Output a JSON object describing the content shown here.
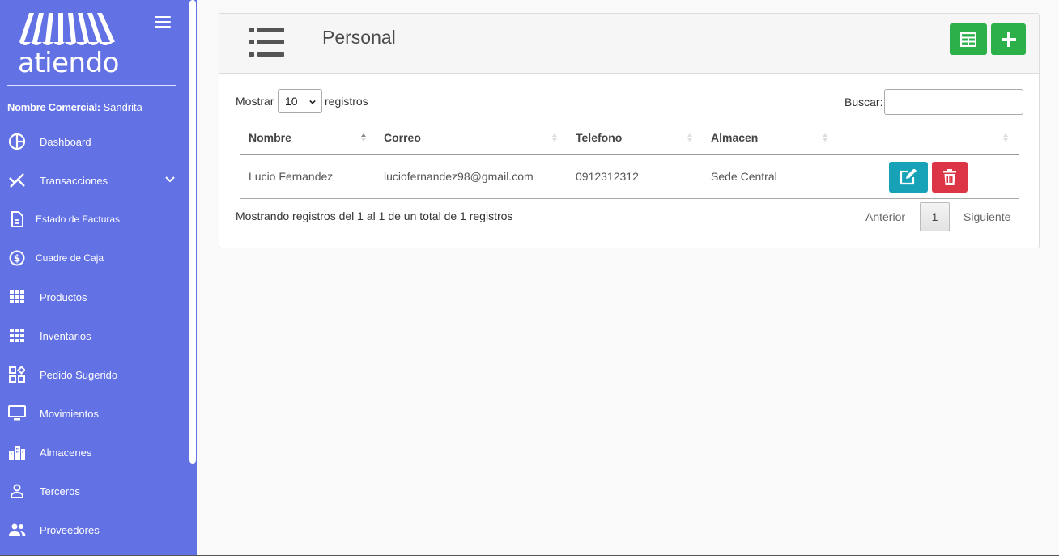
{
  "sidebar": {
    "logo_text": "atiendo",
    "merchant_label": "Nombre Comercial:",
    "merchant_value": " Sandrita",
    "items": [
      {
        "label": "Dashboard",
        "icon": "pie-chart-icon"
      },
      {
        "label": "Transacciones",
        "icon": "transactions-icon"
      },
      {
        "label": "Estado de Facturas",
        "icon": "document-icon"
      },
      {
        "label": "Cuadre de Caja",
        "icon": "dollar-circle-icon"
      },
      {
        "label": "Productos",
        "icon": "grid-icon"
      },
      {
        "label": "Inventarios",
        "icon": "grid-icon"
      },
      {
        "label": "Pedido Sugerido",
        "icon": "widgets-icon"
      },
      {
        "label": "Movimientos",
        "icon": "monitor-icon"
      },
      {
        "label": "Almacenes",
        "icon": "buildings-icon"
      },
      {
        "label": "Terceros",
        "icon": "person-icon"
      },
      {
        "label": "Proveedores",
        "icon": "people-icon"
      }
    ]
  },
  "header": {
    "title": "Personal"
  },
  "table_controls": {
    "show_label": "Mostrar",
    "length_value": "10",
    "records_label": "registros",
    "search_label": "Buscar:",
    "search_value": ""
  },
  "table": {
    "columns": [
      "Nombre",
      "Correo",
      "Telefono",
      "Almacen",
      ""
    ],
    "rows": [
      {
        "nombre": "Lucio Fernandez",
        "correo": "luciofernandez98@gmail.com",
        "telefono": "0912312312",
        "almacen": "Sede Central"
      }
    ]
  },
  "footer": {
    "info": "Mostrando registros del 1 al 1 de un total de 1 registros",
    "prev": "Anterior",
    "current_page": "1",
    "next": "Siguiente"
  },
  "colors": {
    "sidebar": "#6271e4",
    "green": "#2bb04a",
    "edit": "#17a2b8",
    "delete": "#dc3545"
  }
}
